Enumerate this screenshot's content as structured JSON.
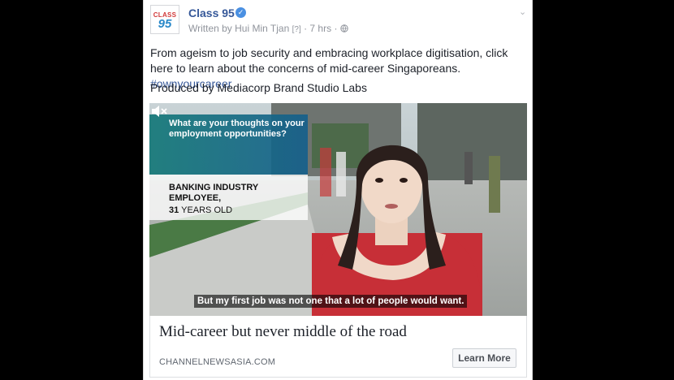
{
  "page": {
    "name": "Class 95"
  },
  "avatar": {
    "line1": "CLASS",
    "line2": "95"
  },
  "post": {
    "author_prefix": "Written by Hui Min Tjan",
    "question_mark": "[?]",
    "separator": "·",
    "time": "7 hrs",
    "privacy_icon": "globe-icon",
    "text_main": "From ageism to job security and embracing workplace digitisation, click here to learn about the concerns of mid-career Singaporeans. ",
    "hashtag": "#ownyourcareer",
    "credit": "Produced by Mediacorp Brand Studio Labs"
  },
  "video": {
    "question": "What are your thoughts on your employment opportunities?",
    "who_title": "BANKING INDUSTRY EMPLOYEE,",
    "who_age_num": "31",
    "who_age_rest": " YEARS OLD",
    "caption": "But my first job was not one that a lot of people would want.",
    "mute_icon": "speaker-muted-icon"
  },
  "link": {
    "headline": "Mid-career but never middle of the road",
    "domain": "CHANNELNEWSASIA.COM",
    "button": "Learn More"
  },
  "colors": {
    "link_blue": "#365899",
    "verified_blue": "#4a90e2",
    "text": "#1d2129",
    "meta_grey": "#90949c"
  }
}
